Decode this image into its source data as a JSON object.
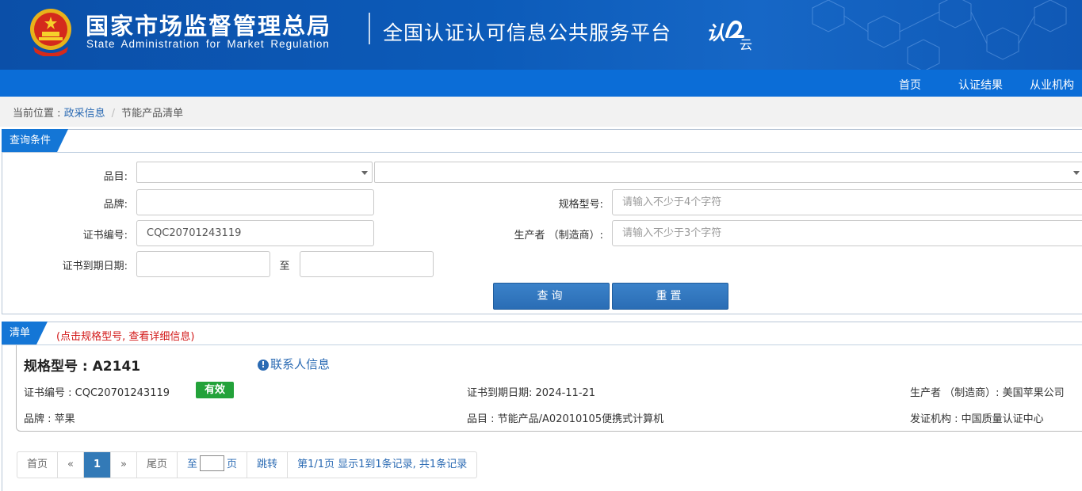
{
  "header": {
    "org_cn": "国家市场监督管理总局",
    "org_en": "State Administration  for  Market Regulation",
    "platform_title": "全国认证认可信息公共服务平台",
    "logo_text": "认",
    "logo_sub": "云",
    "accent_color": "#0b6dd7"
  },
  "nav": {
    "items": [
      "首页",
      "认证结果",
      "从业机构"
    ]
  },
  "breadcrumb": {
    "prefix": "当前位置 : ",
    "link": "政采信息",
    "separator": "/",
    "current": "节能产品清单"
  },
  "query": {
    "panel_title": "查询条件",
    "category_label": "品目:",
    "brand_label": "品牌:",
    "brand_value": "",
    "model_label": "规格型号:",
    "model_placeholder": "请输入不少于4个字符",
    "cert_no_label": "证书编号:",
    "cert_no_value": "CQC20701243119",
    "maker_label": "生产者 （制造商）:",
    "maker_placeholder": "请输入不少于3个字符",
    "expiry_label": "证书到期日期:",
    "to_label": "至",
    "search_button": "查询",
    "reset_button": "重置"
  },
  "results": {
    "panel_title": "清单",
    "tip": "(点击规格型号, 查看详细信息)",
    "items": [
      {
        "model_heading": "规格型号 : A2141",
        "contact_link": "联系人信息",
        "cert_no": "证书编号 : CQC20701243119",
        "status": "有效",
        "status_color": "#23a23a",
        "expiry": "证书到期日期: 2024-11-21",
        "maker": "生产者 （制造商）: 美国苹果公司",
        "brand": "品牌 : 苹果",
        "category": "品目 : 节能产品/A02010105便携式计算机",
        "issuer": "发证机构 : 中国质量认证中心"
      }
    ]
  },
  "pager": {
    "first": "首页",
    "prev": "«",
    "current": "1",
    "next": "»",
    "last": "尾页",
    "goto_prefix": "至",
    "goto_suffix": "页",
    "jump": "跳转",
    "summary": "第1/1页  显示1到1条记录, 共1条记录"
  }
}
